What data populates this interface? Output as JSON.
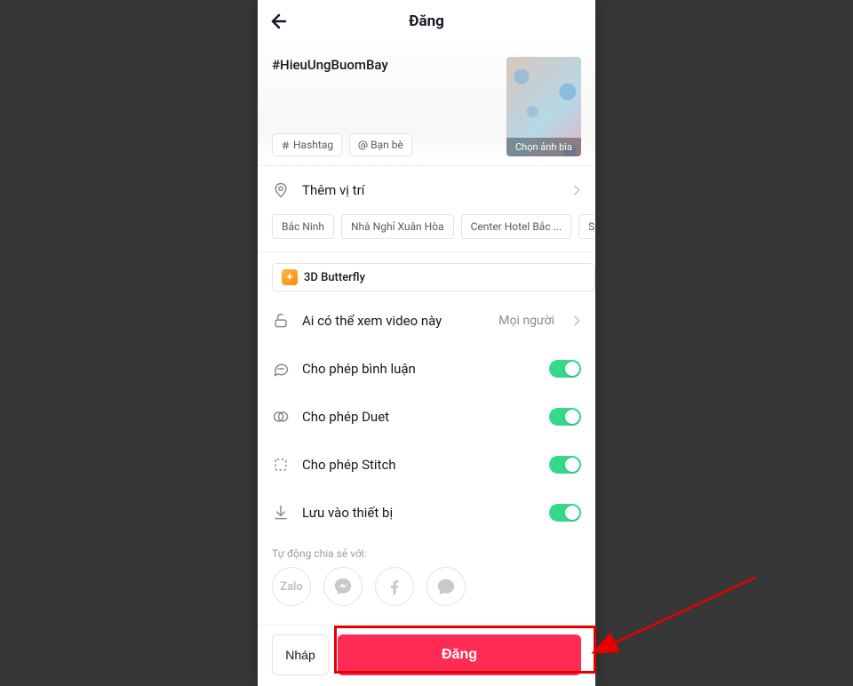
{
  "header": {
    "title": "Đăng"
  },
  "caption": {
    "text": "#HieuUngBuomBay",
    "hashtag_chip": "Hashtag",
    "friends_chip": "Bạn bè",
    "cover_select": "Chọn ảnh bìa"
  },
  "location": {
    "add_label": "Thêm vị trí",
    "suggestions": [
      "Bắc Ninh",
      "Nhà Nghỉ Xuân Hòa",
      "Center Hotel Bắc ...",
      "SUN"
    ]
  },
  "effect": {
    "name": "3D Butterfly"
  },
  "privacy": {
    "label": "Ai có thể xem video này",
    "value": "Mọi người"
  },
  "toggles": {
    "comments": {
      "label": "Cho phép bình luận",
      "on": true
    },
    "duet": {
      "label": "Cho phép Duet",
      "on": true
    },
    "stitch": {
      "label": "Cho phép Stitch",
      "on": true
    },
    "save": {
      "label": "Lưu vào thiết bị",
      "on": true
    }
  },
  "share": {
    "auto_label": "Tự động chia sẻ với:",
    "targets": {
      "zalo": "Zalo",
      "messenger": "messenger-icon",
      "facebook": "facebook-icon",
      "other": "chat-icon"
    }
  },
  "footer": {
    "draft": "Nháp",
    "post": "Đăng"
  },
  "annotation": {
    "highlight": "post-button",
    "color": "#e70000"
  }
}
